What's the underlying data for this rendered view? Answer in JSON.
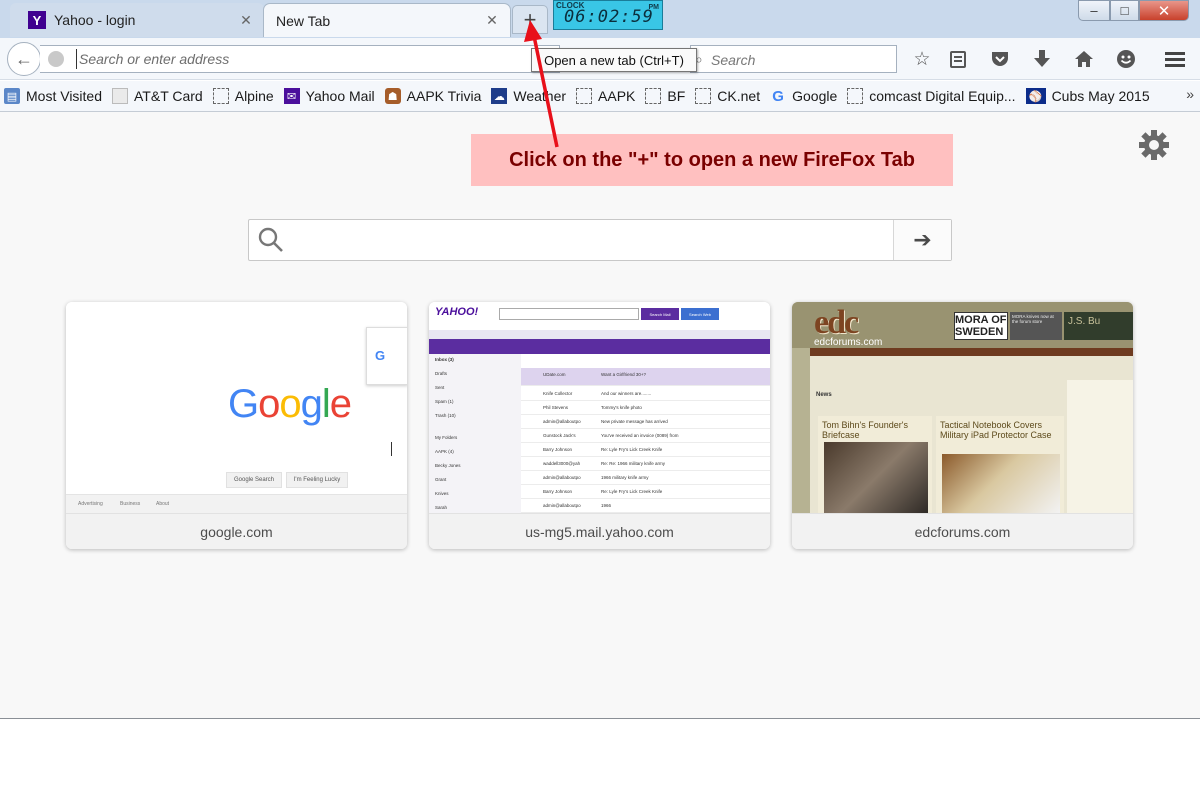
{
  "tabs": [
    {
      "title": "Yahoo - login",
      "favicon": "yahoo-favicon",
      "active": false
    },
    {
      "title": "New Tab",
      "active": true
    }
  ],
  "new_tab_button": "+",
  "clock": {
    "label": "CLOCK",
    "time": "06:02:59",
    "ampm": "PM"
  },
  "window_controls": {
    "minimize": "–",
    "maximize": "□",
    "close": "✕"
  },
  "address_bar": {
    "placeholder": "Search or enter address",
    "value": ""
  },
  "search_bar": {
    "placeholder": "Search"
  },
  "tooltip": "Open a new tab (Ctrl+T)",
  "bookmarks": [
    {
      "label": "Most Visited",
      "icon": "folder-icon"
    },
    {
      "label": "AT&T Card",
      "icon": "page-icon"
    },
    {
      "label": "Alpine",
      "icon": "dashed-page-icon"
    },
    {
      "label": "Yahoo Mail",
      "icon": "yahoo-mail-icon"
    },
    {
      "label": "AAPK Trivia",
      "icon": "aapk-icon"
    },
    {
      "label": "Weather",
      "icon": "weather-icon"
    },
    {
      "label": "AAPK",
      "icon": "dashed-page-icon"
    },
    {
      "label": "BF",
      "icon": "dashed-page-icon"
    },
    {
      "label": "CK.net",
      "icon": "dashed-page-icon"
    },
    {
      "label": "Google",
      "icon": "google-icon"
    },
    {
      "label": "comcast Digital Equip...",
      "icon": "dashed-page-icon"
    },
    {
      "label": "Cubs May 2015",
      "icon": "mlb-icon"
    }
  ],
  "bookmarks_more": "»",
  "callout": "Click on the \"+\" to open a new FireFox Tab",
  "tiles": [
    {
      "label": "google.com"
    },
    {
      "label": "us-mg5.mail.yahoo.com"
    },
    {
      "label": "edcforums.com"
    }
  ],
  "google_thumb": {
    "logo": [
      "G",
      "o",
      "o",
      "g",
      "l",
      "e"
    ],
    "logo_colors": [
      "#4285f4",
      "#ea4335",
      "#fbbc05",
      "#4285f4",
      "#34a853",
      "#ea4335"
    ],
    "search_btn": "Google Search",
    "lucky_btn": "I'm Feeling Lucky",
    "footer": [
      "Advertising",
      "Business",
      "About"
    ]
  },
  "yahoo_thumb": {
    "logo": "YAHOO!",
    "search_mail": "Search Mail",
    "search_web": "Search Web",
    "folders": [
      "Inbox (3)",
      "Drafts",
      "Sent",
      "Spam (1)",
      "Trash (10)",
      "My Folders",
      "AAPK (4)",
      "Becky Jones",
      "Grant",
      "Knives",
      "Sarah"
    ],
    "rows": [
      {
        "from": "UDate.com",
        "subject": "Want a Girlfriend 30+?"
      },
      {
        "from": "Knife Collector",
        "subject": "And our winners are........"
      },
      {
        "from": "Phil Stevens",
        "subject": "Tommy's knife photo"
      },
      {
        "from": "admin@allaboutpo",
        "subject": "New private message has arrived"
      },
      {
        "from": "Gunstock Jack's",
        "subject": "You've received an invoice (0089) from"
      },
      {
        "from": "Barry Johnson",
        "subject": "Re: Lyle Fry's Lick Creek Knife"
      },
      {
        "from": "waddell3000@yah",
        "subject": "Re: Re: 1966 military knife army"
      },
      {
        "from": "admin@allaboutpo",
        "subject": "1966 military knife army"
      },
      {
        "from": "Barry Johnson",
        "subject": "Re: Lyle Fry's Lick Creek Knife"
      },
      {
        "from": "admin@allaboutpo",
        "subject": "1966"
      }
    ]
  },
  "edc_thumb": {
    "logo": "edc",
    "logo_sub": "edcforums.com",
    "ad1": "MORA OF SWEDEN",
    "ad2": "MORA knives now at the forum store",
    "ad3": "J.S. Bu",
    "news": "News",
    "card1": "Tom Bihn's Founder's Briefcase",
    "card2": "Tactical Notebook Covers Military iPad Protector Case"
  },
  "colors": {
    "tabstrip": "#c9d9ec",
    "callout_bg": "#ffc0c0",
    "callout_text": "#7a0000",
    "arrow": "#e8101a"
  }
}
